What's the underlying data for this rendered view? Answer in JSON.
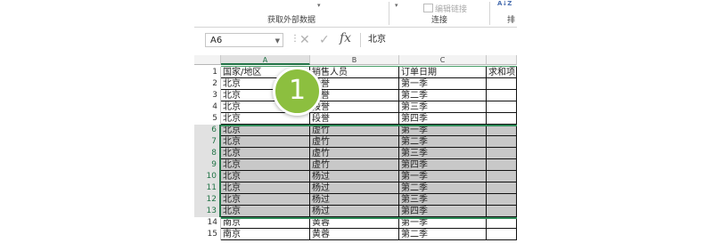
{
  "ribbon": {
    "group_external_data": "获取外部数据",
    "group_connections": "连接",
    "edit_links_label": "编辑链接",
    "group_sort_label": "排",
    "sort_icon_text": "A↓Z"
  },
  "formula_bar": {
    "name_box": "A6",
    "cancel_icon": "✕",
    "confirm_icon": "✓",
    "fx_label": "fx",
    "formula_value": "北京"
  },
  "grid": {
    "columns": [
      "A",
      "B",
      "C"
    ],
    "rows": [
      {
        "num": "1",
        "cells": [
          "国家/地区",
          "销售人员",
          "订单日期",
          "求和项"
        ],
        "selected": false
      },
      {
        "num": "2",
        "cells": [
          "北京",
          "段誉",
          "第一季",
          ""
        ],
        "selected": false
      },
      {
        "num": "3",
        "cells": [
          "北京",
          "段誉",
          "第二季",
          ""
        ],
        "selected": false
      },
      {
        "num": "4",
        "cells": [
          "北京",
          "段誉",
          "第三季",
          ""
        ],
        "selected": false
      },
      {
        "num": "5",
        "cells": [
          "北京",
          "段誉",
          "第四季",
          ""
        ],
        "selected": false
      },
      {
        "num": "6",
        "cells": [
          "北京",
          "虚竹",
          "第一季",
          ""
        ],
        "selected": true
      },
      {
        "num": "7",
        "cells": [
          "北京",
          "虚竹",
          "第二季",
          ""
        ],
        "selected": true
      },
      {
        "num": "8",
        "cells": [
          "北京",
          "虚竹",
          "第三季",
          ""
        ],
        "selected": true
      },
      {
        "num": "9",
        "cells": [
          "北京",
          "虚竹",
          "第四季",
          ""
        ],
        "selected": true
      },
      {
        "num": "10",
        "cells": [
          "北京",
          "杨过",
          "第一季",
          ""
        ],
        "selected": true
      },
      {
        "num": "11",
        "cells": [
          "北京",
          "杨过",
          "第二季",
          ""
        ],
        "selected": true
      },
      {
        "num": "12",
        "cells": [
          "北京",
          "杨过",
          "第三季",
          ""
        ],
        "selected": true
      },
      {
        "num": "13",
        "cells": [
          "北京",
          "杨过",
          "第四季",
          ""
        ],
        "selected": true
      },
      {
        "num": "14",
        "cells": [
          "南京",
          "黄蓉",
          "第一季",
          ""
        ],
        "selected": false
      },
      {
        "num": "15",
        "cells": [
          "南京",
          "黄蓉",
          "第二季",
          ""
        ],
        "selected": false
      }
    ]
  },
  "step_badge": {
    "number": "1",
    "color": "#8cbf3f"
  },
  "colors": {
    "selection_green": "#217346",
    "selected_row_fill": "#c8c8c8"
  }
}
